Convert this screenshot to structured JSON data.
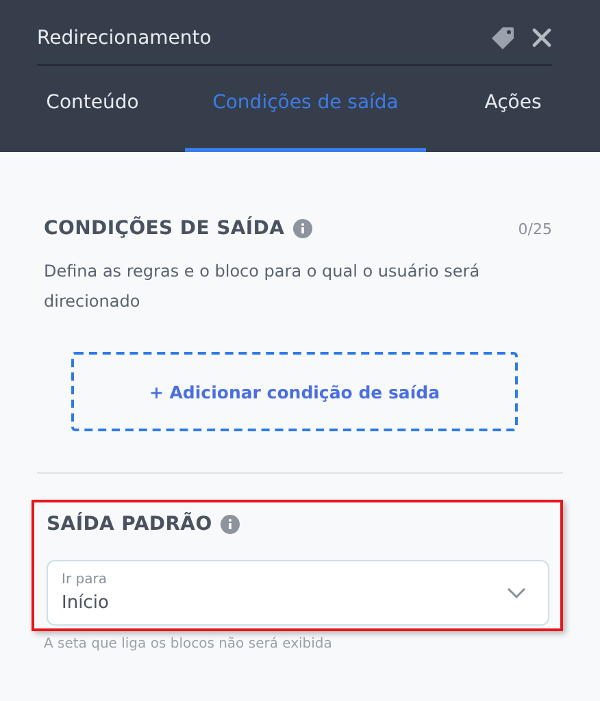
{
  "header": {
    "title": "Redirecionamento"
  },
  "tabs": [
    {
      "label": "Conteúdo",
      "selected": false
    },
    {
      "label": "Condições de saída",
      "selected": true
    },
    {
      "label": "Ações",
      "selected": false
    }
  ],
  "exit_conditions": {
    "title": "CONDIÇÕES DE SAÍDA",
    "counter": "0/25",
    "description": "Defina as regras e o bloco para o qual o usuário será direcionado",
    "add_button": "+ Adicionar condição de saída"
  },
  "default_exit": {
    "highlighted": true,
    "title": "SAÍDA PADRÃO",
    "select": {
      "label": "Ir para",
      "value": "Início"
    },
    "hint": "A seta que liga os blocos não será exibida"
  }
}
